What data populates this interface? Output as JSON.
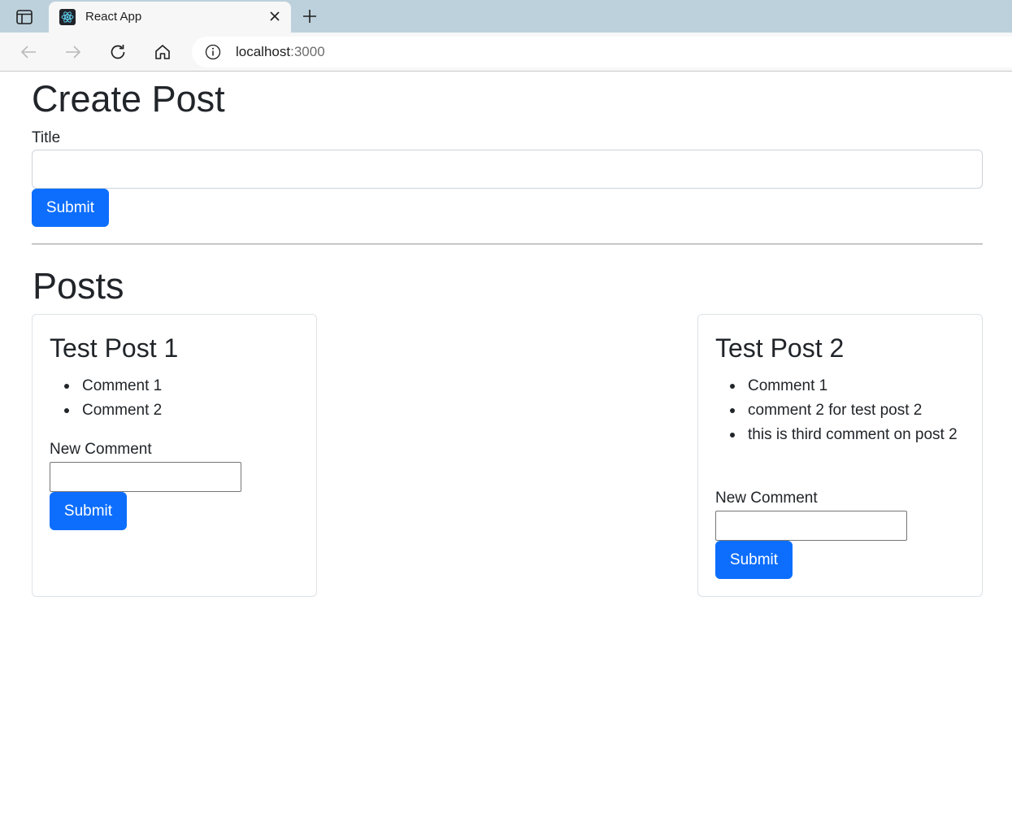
{
  "browser": {
    "tab_title": "React App",
    "url_host": "localhost",
    "url_port": ":3000",
    "icons": [
      "sidebar-toggle-icon",
      "react-favicon",
      "close-icon",
      "plus-icon",
      "back-arrow-icon",
      "forward-arrow-icon",
      "reload-icon",
      "home-icon",
      "info-icon"
    ]
  },
  "create_post": {
    "heading": "Create Post",
    "title_label": "Title",
    "title_value": "",
    "submit_label": "Submit"
  },
  "posts_section": {
    "heading": "Posts"
  },
  "posts": [
    {
      "title": "Test Post 1",
      "comments": [
        "Comment 1",
        "Comment 2"
      ],
      "new_comment_label": "New Comment",
      "new_comment_value": "",
      "submit_label": "Submit"
    },
    {
      "title": "Test Post 2",
      "comments": [
        "Comment 1",
        "comment 2 for test post 2",
        "this is third comment on post 2"
      ],
      "new_comment_label": "New Comment",
      "new_comment_value": "",
      "submit_label": "Submit"
    }
  ],
  "colors": {
    "primary": "#0d6efd",
    "tabbar": "#bdd1dc",
    "text": "#212529"
  }
}
